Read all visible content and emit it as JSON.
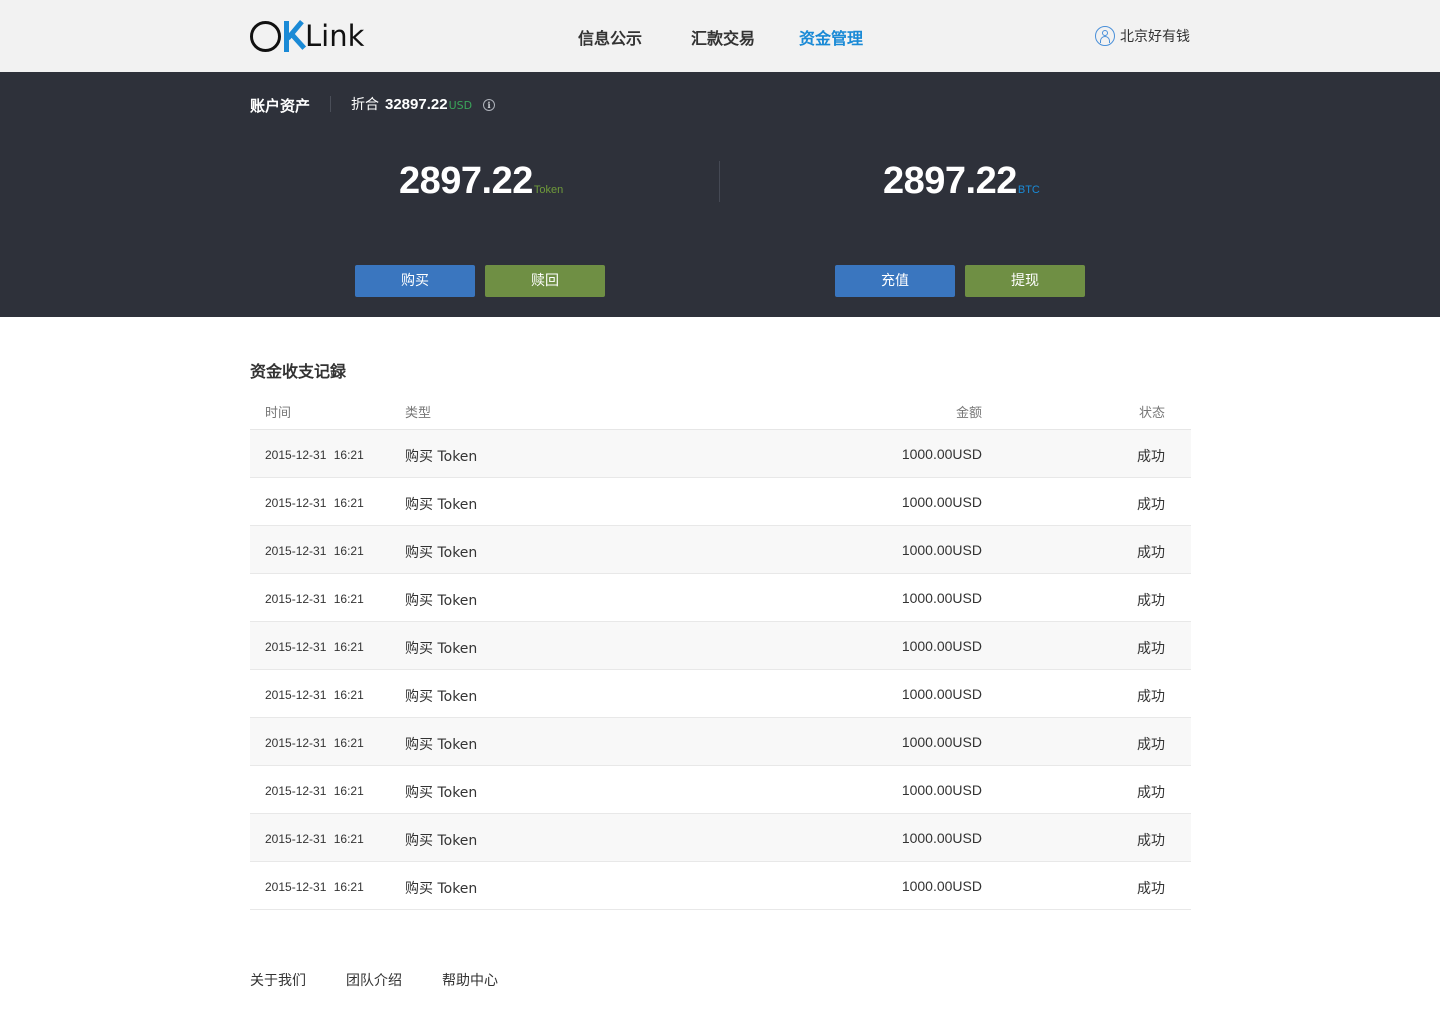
{
  "header": {
    "logo_text": "Link",
    "nav": [
      {
        "label": "信息公示",
        "active": false
      },
      {
        "label": "汇款交易",
        "active": false
      },
      {
        "label": "资金管理",
        "active": true
      }
    ],
    "user_name": "北京好有钱"
  },
  "assets": {
    "title": "账户资产",
    "total_label": "折合",
    "total_value": "32897.22",
    "total_unit": "USD",
    "token_balance": {
      "value": "2897.22",
      "unit": "Token",
      "unit_color": "#6f9a3a"
    },
    "btc_balance": {
      "value": "2897.22",
      "unit": "BTC",
      "unit_color": "#1a8ad6"
    },
    "buttons": {
      "buy": "购买",
      "redeem": "赎回",
      "deposit": "充值",
      "withdraw": "提现"
    }
  },
  "records": {
    "title": "资金收支记録",
    "columns": {
      "time": "时间",
      "type": "类型",
      "amount": "金额",
      "status": "状态"
    },
    "rows": [
      {
        "time": "2015-12-31 16:21",
        "type": "购买 Token",
        "amount": "1000.00USD",
        "status": "成功"
      },
      {
        "time": "2015-12-31 16:21",
        "type": "购买 Token",
        "amount": "1000.00USD",
        "status": "成功"
      },
      {
        "time": "2015-12-31 16:21",
        "type": "购买 Token",
        "amount": "1000.00USD",
        "status": "成功"
      },
      {
        "time": "2015-12-31 16:21",
        "type": "购买 Token",
        "amount": "1000.00USD",
        "status": "成功"
      },
      {
        "time": "2015-12-31 16:21",
        "type": "购买 Token",
        "amount": "1000.00USD",
        "status": "成功"
      },
      {
        "time": "2015-12-31 16:21",
        "type": "购买 Token",
        "amount": "1000.00USD",
        "status": "成功"
      },
      {
        "time": "2015-12-31 16:21",
        "type": "购买 Token",
        "amount": "1000.00USD",
        "status": "成功"
      },
      {
        "time": "2015-12-31 16:21",
        "type": "购买 Token",
        "amount": "1000.00USD",
        "status": "成功"
      },
      {
        "time": "2015-12-31 16:21",
        "type": "购买 Token",
        "amount": "1000.00USD",
        "status": "成功"
      },
      {
        "time": "2015-12-31 16:21",
        "type": "购买 Token",
        "amount": "1000.00USD",
        "status": "成功"
      }
    ]
  },
  "footer": {
    "links": [
      "关于我们",
      "团队介绍",
      "帮助中心"
    ]
  }
}
